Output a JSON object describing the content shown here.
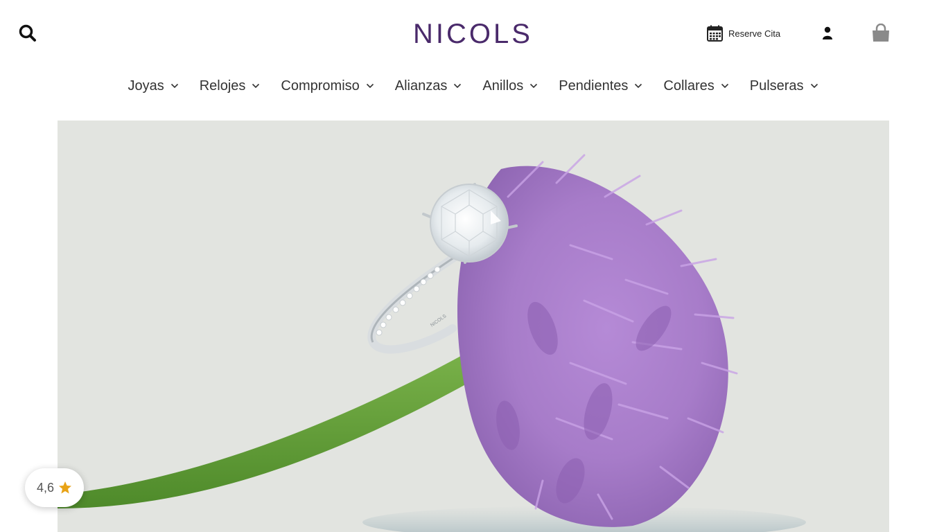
{
  "brand": {
    "name": "NICOLS",
    "color": "#4a2a6b"
  },
  "header": {
    "search_icon": "search-icon",
    "reserve_label": "Reserve Cita",
    "reserve_icon": "calendar-icon",
    "account_icon": "user-icon",
    "cart_icon": "shopping-bag-icon"
  },
  "nav": {
    "items": [
      {
        "label": "Joyas"
      },
      {
        "label": "Relojes"
      },
      {
        "label": "Compromiso"
      },
      {
        "label": "Alianzas"
      },
      {
        "label": "Anillos"
      },
      {
        "label": "Pendientes"
      },
      {
        "label": "Collares"
      },
      {
        "label": "Pulseras"
      }
    ]
  },
  "hero": {
    "engraving": "NICOLS"
  },
  "rating": {
    "value": "4,6",
    "icon": "star-icon",
    "star_color": "#e8a317"
  }
}
